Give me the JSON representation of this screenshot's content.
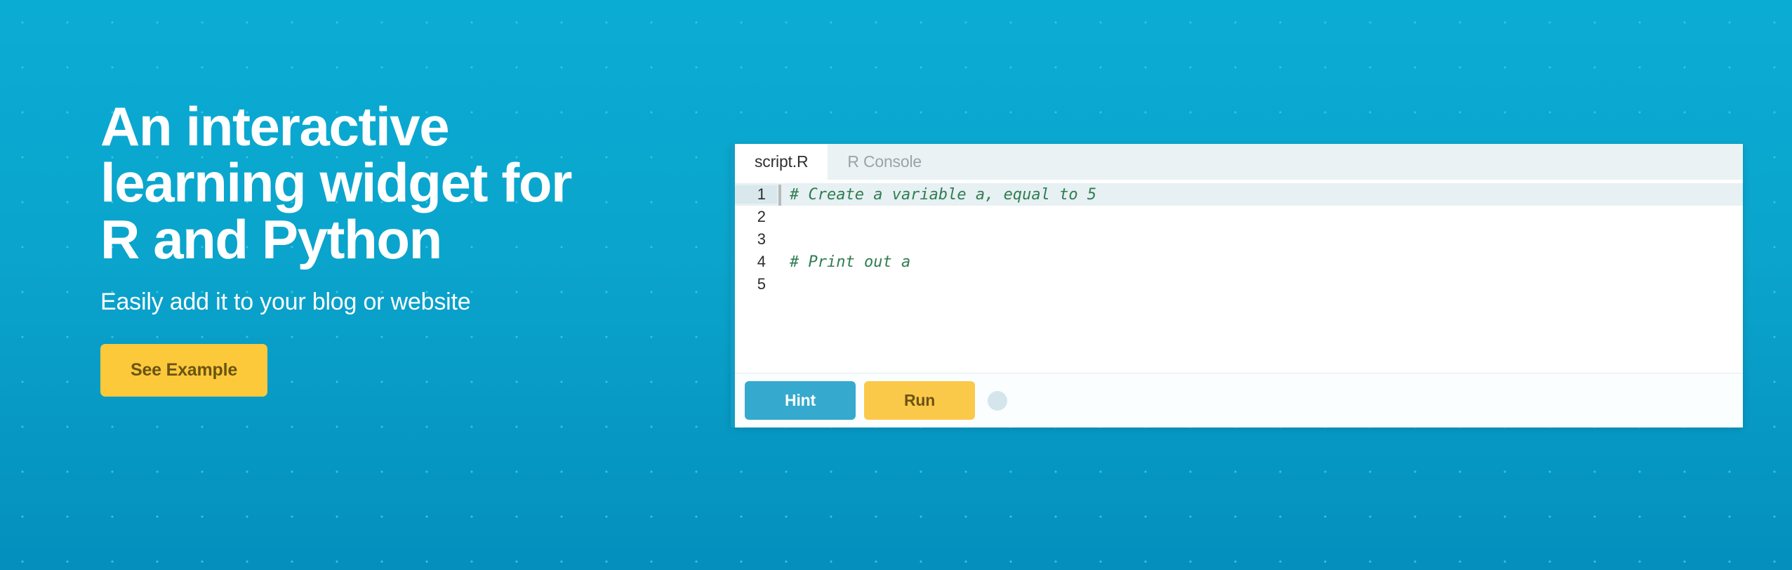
{
  "hero": {
    "headline": "An interactive\nlearning widget for\nR and Python",
    "subhead": "Easily add it to your blog or website",
    "cta_label": "See Example",
    "bg_color_top": "#0bacd4",
    "bg_color_bottom": "#048fbd",
    "accent_yellow": "#fcc93b"
  },
  "widget": {
    "tabs": [
      {
        "label": "script.R",
        "active": true
      },
      {
        "label": "R Console",
        "active": false
      }
    ],
    "editor": {
      "lines": [
        {
          "number": "1",
          "text": "# Create a variable a, equal to 5",
          "active": true
        },
        {
          "number": "2",
          "text": "",
          "active": false
        },
        {
          "number": "3",
          "text": "",
          "active": false
        },
        {
          "number": "4",
          "text": "# Print out a",
          "active": false
        },
        {
          "number": "5",
          "text": "",
          "active": false
        }
      ],
      "comment_color": "#2f7d52"
    },
    "footer": {
      "hint_label": "Hint",
      "run_label": "Run",
      "hint_color": "#36a9ce",
      "run_color": "#fbc94a",
      "status_dot_color": "#d4e6ec"
    }
  }
}
